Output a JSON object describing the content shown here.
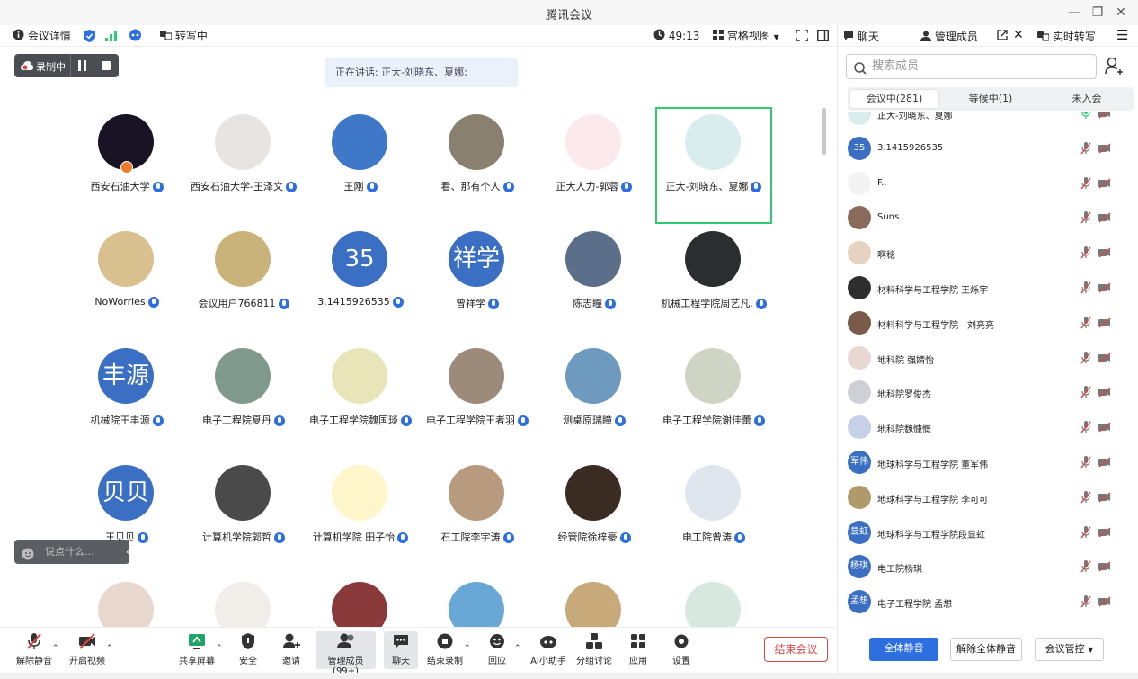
{
  "window": {
    "title": "腾讯会议",
    "minimize": "—",
    "maximize": "❐",
    "close": "✕"
  },
  "topbar": {
    "meeting_info": "会议详情",
    "transcribe": "转写中",
    "timer": "49:13",
    "view_mode": "宫格视图"
  },
  "recording": {
    "label": "录制中"
  },
  "speaking": {
    "text": "正在讲话: 正大-刘晓东、夏娜;"
  },
  "chat_input": {
    "placeholder": "说点什么..."
  },
  "colors": {
    "accent": "#2d6fe0",
    "avatar_blue": "#3a6fc4",
    "danger": "#e04545",
    "active_border": "#2ecc71"
  },
  "grid": [
    {
      "name": "西安石油大学",
      "avatar": "cat-image",
      "avatar_text": "",
      "bg": "#1a1326"
    },
    {
      "name": "西安石油大学-王泽文",
      "avatar": "anime-boy-image",
      "avatar_text": "",
      "bg": "#e8e4e2"
    },
    {
      "name": "王刚",
      "avatar": "sky-image",
      "avatar_text": "",
      "bg": "#3f78c8"
    },
    {
      "name": "看、那有个人",
      "avatar": "photo-image",
      "avatar_text": "",
      "bg": "#8a8070"
    },
    {
      "name": "正大人力-郭蓉",
      "avatar": "bear-image",
      "avatar_text": "",
      "bg": "#fbe9ee"
    },
    {
      "name": "正大-刘晓东、夏娜",
      "avatar": "girl-image",
      "avatar_text": "",
      "bg": "#d9ecee"
    },
    {
      "name": "NoWorries",
      "avatar": "cartoon-image",
      "avatar_text": "",
      "bg": "#d8c08f"
    },
    {
      "name": "会议用户766811",
      "avatar": "dog-image",
      "avatar_text": "",
      "bg": "#c9b37a"
    },
    {
      "name": "3.1415926535",
      "avatar": "",
      "avatar_text": "35",
      "bg": "#3a6fc4"
    },
    {
      "name": "曾祥学",
      "avatar": "",
      "avatar_text": "祥学",
      "bg": "#3a6fc4"
    },
    {
      "name": "陈志瞳",
      "avatar": "sunset-image",
      "avatar_text": "",
      "bg": "#5b6f8a"
    },
    {
      "name": "机械工程学院周艺凡.",
      "avatar": "dark-anime-image",
      "avatar_text": "",
      "bg": "#2b2e2e"
    },
    {
      "name": "机械院王丰源",
      "avatar": "",
      "avatar_text": "丰源",
      "bg": "#3a6fc4"
    },
    {
      "name": "电子工程院夏丹",
      "avatar": "bride-image",
      "avatar_text": "",
      "bg": "#7f9a8c"
    },
    {
      "name": "电子工程学院魏国琰",
      "avatar": "duck-image",
      "avatar_text": "",
      "bg": "#e8e6b8"
    },
    {
      "name": "电子工程学院王者羽",
      "avatar": "man-image",
      "avatar_text": "",
      "bg": "#9c8a7a"
    },
    {
      "name": "测桌原瑞瞳",
      "avatar": "anime-eyes-image",
      "avatar_text": "",
      "bg": "#6f9ac0"
    },
    {
      "name": "电子工程学院谢佳蕾",
      "avatar": "silhouette-image",
      "avatar_text": "",
      "bg": "#cfd4c4"
    },
    {
      "name": "王贝贝",
      "avatar": "",
      "avatar_text": "贝贝",
      "bg": "#3a6fc4"
    },
    {
      "name": "计算机学院郭哲",
      "avatar": "person-dark-image",
      "avatar_text": "",
      "bg": "#4a4a4a"
    },
    {
      "name": "计算机学院 田子怡",
      "avatar": "sun-image",
      "avatar_text": "",
      "bg": "#fff6cc"
    },
    {
      "name": "石工院李宇涛",
      "avatar": "puppy-image",
      "avatar_text": "",
      "bg": "#b89a7e"
    },
    {
      "name": "经管院徐梓豪",
      "avatar": "city-image",
      "avatar_text": "",
      "bg": "#3a2c22"
    },
    {
      "name": "电工院曾涛",
      "avatar": "anime-boy2-image",
      "avatar_text": "",
      "bg": "#dfe6ee"
    },
    {
      "name": "",
      "avatar": "cartoon2-image",
      "avatar_text": "",
      "bg": "#e7d7cc"
    },
    {
      "name": "",
      "avatar": "cat-cartoon-image",
      "avatar_text": "",
      "bg": "#f1eee9"
    },
    {
      "name": "",
      "avatar": "red-image",
      "avatar_text": "",
      "bg": "#8a3a3a"
    },
    {
      "name": "",
      "avatar": "anime-blue-image",
      "avatar_text": "",
      "bg": "#69a7d6"
    },
    {
      "name": "",
      "avatar": "girl2-image",
      "avatar_text": "",
      "bg": "#c8a97a"
    },
    {
      "name": "",
      "avatar": "bird-image",
      "avatar_text": "",
      "bg": "#d6e8df"
    }
  ],
  "toolbar": {
    "unmute": "解除静音",
    "video": "开启视频",
    "share": "共享屏幕",
    "security": "安全",
    "invite": "邀请",
    "members": "管理成员(99+)",
    "chat": "聊天",
    "stop_record": "结束录制",
    "react": "回应",
    "ai": "AI小助手",
    "breakout": "分组讨论",
    "apps": "应用",
    "settings": "设置",
    "end": "结束会议"
  },
  "side": {
    "tab_chat": "聊天",
    "tab_members": "管理成员",
    "tab_transcript": "实时转写",
    "search_placeholder": "搜索成员",
    "seg_in": "会议中(281)",
    "seg_wait": "等候中(1)",
    "seg_not": "未入会",
    "mute_all": "全体静音",
    "unmute_all": "解除全体静音",
    "control": "会议管控"
  },
  "members": [
    {
      "name": "正大-刘晓东、夏娜",
      "avatar_text": "",
      "bg": "#d9ecee",
      "mic": "on"
    },
    {
      "name": "3.1415926535",
      "avatar_text": "35",
      "bg": "#3a6fc4",
      "mic": "off"
    },
    {
      "name": "F..",
      "avatar_text": "",
      "bg": "#f3f3f3",
      "mic": "off"
    },
    {
      "name": "Suns",
      "avatar_text": "",
      "bg": "#8a6a5a",
      "mic": "off"
    },
    {
      "name": "啊稔",
      "avatar_text": "",
      "bg": "#e6d2c0",
      "mic": "off"
    },
    {
      "name": "材料科学与工程学院 王烁宇",
      "avatar_text": "",
      "bg": "#2e2e2e",
      "mic": "off"
    },
    {
      "name": "材料科学与工程学院—刘亮亮",
      "avatar_text": "",
      "bg": "#7a5a4a",
      "mic": "off"
    },
    {
      "name": "地科院 强婧怡",
      "avatar_text": "",
      "bg": "#e9d7d2",
      "mic": "off"
    },
    {
      "name": "地科院罗俊杰",
      "avatar_text": "",
      "bg": "#cfcfd6",
      "mic": "off"
    },
    {
      "name": "地科院魏慷慨",
      "avatar_text": "",
      "bg": "#c6d0e6",
      "mic": "off"
    },
    {
      "name": "地球科学与工程学院 董军伟",
      "avatar_text": "军伟",
      "bg": "#3a6fc4",
      "mic": "off"
    },
    {
      "name": "地球科学与工程学院 李可可",
      "avatar_text": "",
      "bg": "#b09a6a",
      "mic": "off"
    },
    {
      "name": "地球科学与工程学院段显虹",
      "avatar_text": "显虹",
      "bg": "#3a6fc4",
      "mic": "off"
    },
    {
      "name": "电工院杨琪",
      "avatar_text": "杨琪",
      "bg": "#3a6fc4",
      "mic": "off"
    },
    {
      "name": "电子工程学院 孟想",
      "avatar_text": "孟想",
      "bg": "#3a6fc4",
      "mic": "off"
    }
  ]
}
